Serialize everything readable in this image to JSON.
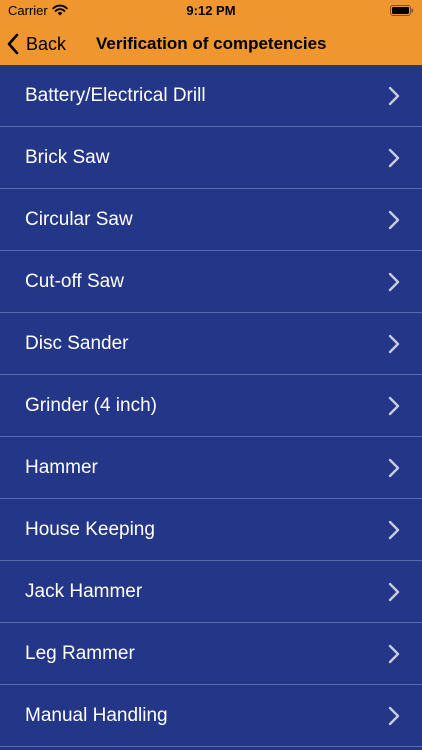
{
  "status_bar": {
    "carrier": "Carrier",
    "time": "9:12 PM"
  },
  "nav": {
    "back_label": "Back",
    "title": "Verification of competencies"
  },
  "colors": {
    "header_background": "#ef962f",
    "list_background": "#243688",
    "separator": "#5a6aa8",
    "row_text": "#ffffff"
  },
  "icons": {
    "back": "chevron-left-icon",
    "row_disclosure": "chevron-right-icon",
    "wifi": "wifi-icon",
    "battery": "battery-icon"
  },
  "competencies": [
    {
      "label": "Battery/Electrical Drill"
    },
    {
      "label": "Brick Saw"
    },
    {
      "label": "Circular Saw"
    },
    {
      "label": "Cut-off Saw"
    },
    {
      "label": "Disc Sander"
    },
    {
      "label": "Grinder (4 inch)"
    },
    {
      "label": "Hammer"
    },
    {
      "label": "House Keeping"
    },
    {
      "label": "Jack Hammer"
    },
    {
      "label": "Leg Rammer"
    },
    {
      "label": "Manual Handling"
    }
  ]
}
